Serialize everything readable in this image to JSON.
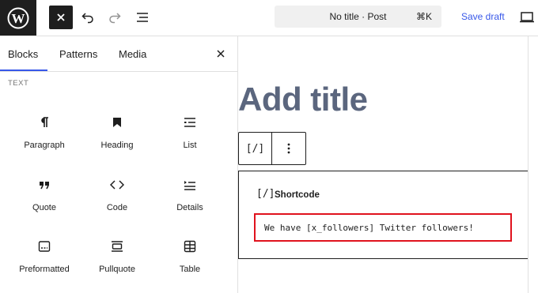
{
  "topbar": {
    "logo_icon": "wordpress-logo-icon",
    "close_icon": "close-icon",
    "undo_icon": "undo-icon",
    "redo_icon": "redo-icon",
    "list_view_icon": "list-view-icon",
    "document_title": "No title · Post",
    "document_shortcut": "⌘K",
    "save_draft_label": "Save draft",
    "view_icon": "desktop-view-icon"
  },
  "inserter": {
    "tabs": [
      {
        "label": "Blocks",
        "active": true
      },
      {
        "label": "Patterns",
        "active": false
      },
      {
        "label": "Media",
        "active": false
      }
    ],
    "close_icon": "close-icon",
    "category_label": "TEXT",
    "blocks": [
      {
        "label": "Paragraph",
        "icon": "paragraph-icon"
      },
      {
        "label": "Heading",
        "icon": "heading-bookmark-icon"
      },
      {
        "label": "List",
        "icon": "list-icon"
      },
      {
        "label": "Quote",
        "icon": "quote-icon"
      },
      {
        "label": "Code",
        "icon": "code-icon"
      },
      {
        "label": "Details",
        "icon": "details-icon"
      },
      {
        "label": "Preformatted",
        "icon": "preformatted-icon"
      },
      {
        "label": "Pullquote",
        "icon": "pullquote-icon"
      },
      {
        "label": "Table",
        "icon": "table-icon"
      }
    ]
  },
  "editor": {
    "title_placeholder": "Add title",
    "block_toolbar": {
      "type_icon_text": "[/]",
      "more_icon": "more-vertical-icon"
    },
    "shortcode_block": {
      "icon_text": "[/]",
      "label": "Shortcode",
      "value": "We have [x_followers] Twitter followers!"
    },
    "highlight_color": "#e0121d"
  },
  "colors": {
    "accent": "#3858e9",
    "dark": "#1e1e1e",
    "title_placeholder": "#5b667e"
  }
}
